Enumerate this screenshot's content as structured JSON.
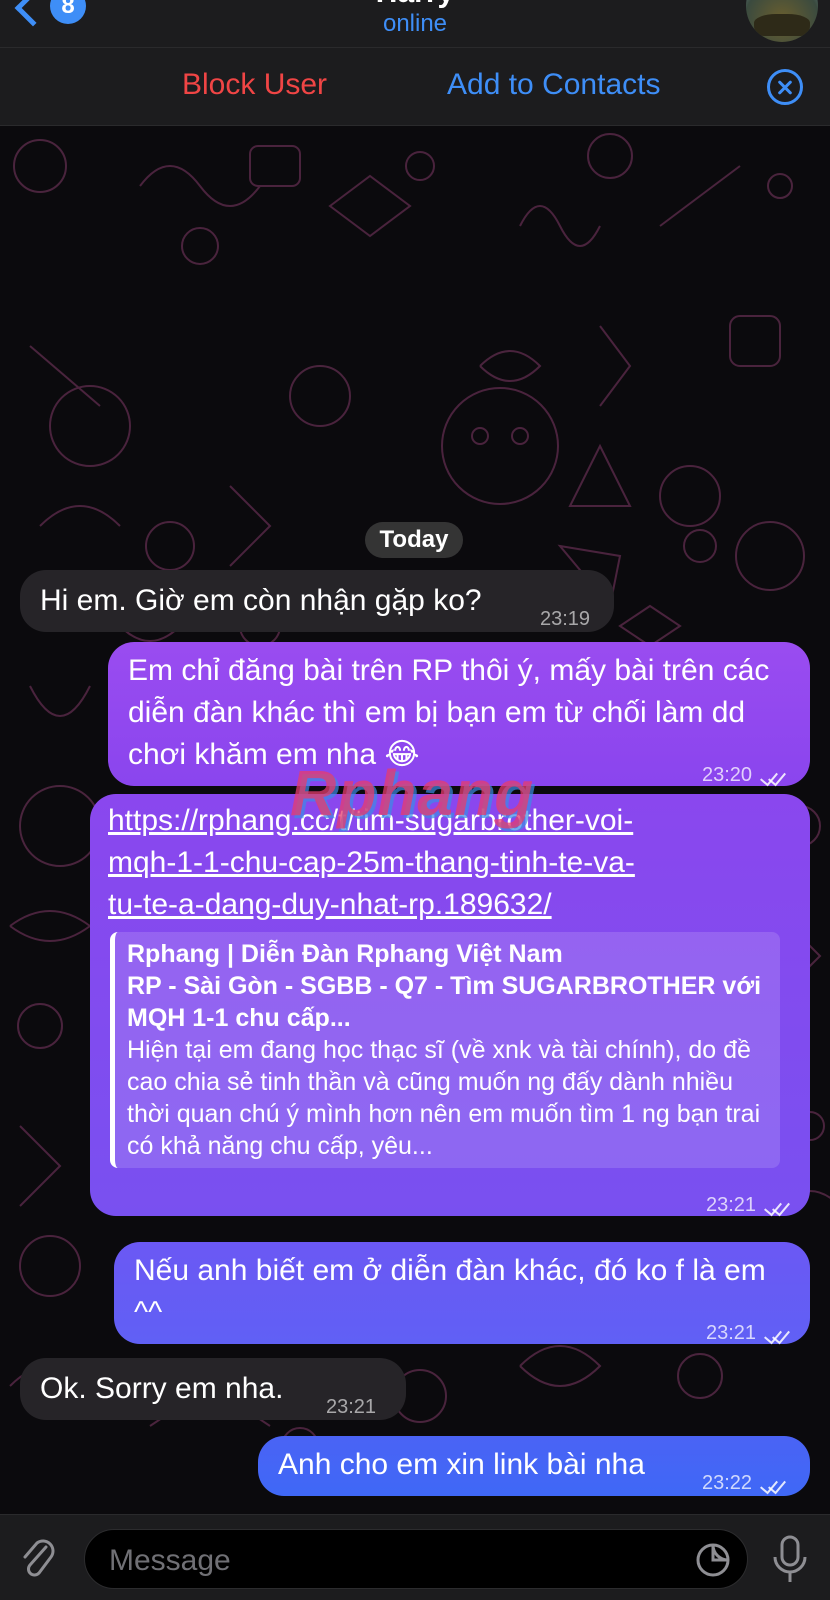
{
  "header": {
    "back_count": "8",
    "title": "Harry",
    "status": "online"
  },
  "actions": {
    "block_label": "Block User",
    "add_label": "Add to Contacts"
  },
  "chat": {
    "date_separator": "Today",
    "messages": [
      {
        "direction": "in",
        "text": "Hi em. Giờ em còn nhận gặp ko?",
        "time": "23:19"
      },
      {
        "direction": "out",
        "text": "Em chỉ đăng bài trên RP thôi ý, mấy bài trên các diễn đàn khác thì em bị bạn em từ chối làm dd chơi khăm em nha 😂",
        "time": "23:20"
      },
      {
        "direction": "out",
        "link": "https://rphang.cc/t/tim-sugarbrother-voi-mqh-1-1-chu-cap-25m-thang-tinh-te-va-tu-te-a-dang-duy-nhat-rp.189632/",
        "link_lines": [
          "https://rphang.cc/t/tim-sugarbrother-voi-",
          "mqh-1-1-chu-cap-25m-thang-tinh-te-va-",
          "tu-te-a-dang-duy-nhat-rp.189632/"
        ],
        "preview_site": "Rphang | Diễn Đàn Rphang Việt Nam",
        "preview_title": "RP - Sài Gòn - SGBB - Q7 - Tìm SUGARBROTHER với MQH 1-1 chu cấp...",
        "preview_desc": "Hiện tại em đang học thạc sĩ (về xnk và tài chính), do đề cao chia sẻ tinh thần và cũng muốn ng đấy dành nhiều thời quan chú ý mình hơn nên em muốn tìm 1 ng bạn trai có khả năng chu cấp, yêu...",
        "time": "23:21"
      },
      {
        "direction": "out",
        "text": "Nếu anh biết em ở diễn đàn khác, đó ko f là em ^^",
        "time": "23:21"
      },
      {
        "direction": "in",
        "text": "Ok. Sorry em nha.",
        "time": "23:21"
      },
      {
        "direction": "out",
        "text": "Anh cho em xin link bài nha",
        "time": "23:22"
      }
    ]
  },
  "watermark": "Rphang",
  "input": {
    "placeholder": "Message"
  },
  "colors": {
    "accent": "#3e8ef7",
    "danger": "#f04545",
    "bubble_in": "#262428"
  }
}
